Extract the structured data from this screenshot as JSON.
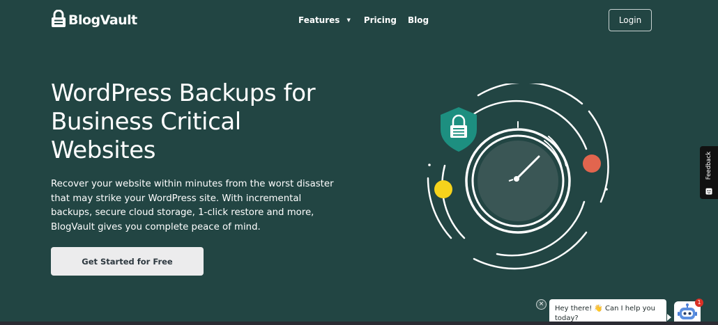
{
  "brand": {
    "name": "BlogVault"
  },
  "nav": {
    "features": "Features",
    "pricing": "Pricing",
    "blog": "Blog",
    "login": "Login"
  },
  "hero": {
    "title": "WordPress Backups for Business Critical Websites",
    "description": "Recover your website within minutes from the worst disaster that may strike your WordPress site. With incremental backups, secure cloud storage, 1-click restore and more, BlogVault gives you complete peace of mind.",
    "cta": "Get Started for Free"
  },
  "feedback": {
    "label": "Feedback"
  },
  "chat": {
    "message": "Hey there! 👋 Can I help you today?",
    "badge": "1"
  },
  "colors": {
    "background": "#224543",
    "shield": "#1d8f80",
    "accent_yellow": "#f6d31c",
    "accent_red": "#e2654e",
    "button_bg": "#ececed",
    "button_text": "#2e3940"
  },
  "icons": [
    "lock-logo-icon",
    "chevron-down-icon",
    "shield-lock-icon",
    "gauge-icon",
    "feedback-icon",
    "close-icon",
    "chatbot-avatar-icon"
  ]
}
